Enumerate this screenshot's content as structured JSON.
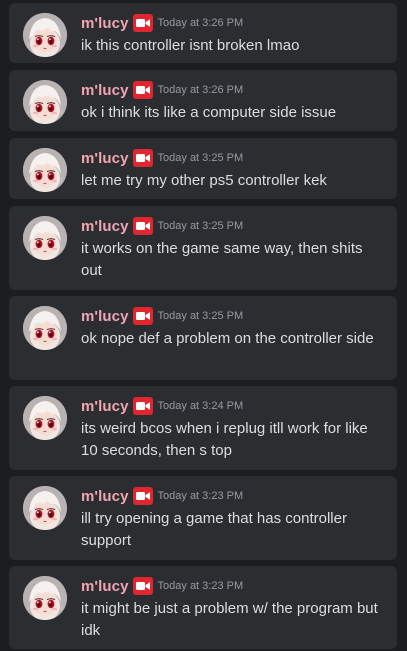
{
  "colors": {
    "background": "#1c1d21",
    "card": "#2b2d31",
    "username": "#f0a6b0",
    "badge": "#e0262f",
    "timestamp": "#949ba4",
    "message_text": "#dbdee1"
  },
  "badge_icon": "video-camera-icon",
  "messages": [
    {
      "username": "m'lucy",
      "time": "Today at 3:26 PM",
      "text": "ik this controller isnt broken lmao"
    },
    {
      "username": "m'lucy",
      "time": "Today at 3:26 PM",
      "text": "ok i think its like a computer side issue"
    },
    {
      "username": "m'lucy",
      "time": "Today at 3:25 PM",
      "text": "let me try my other ps5 controller kek"
    },
    {
      "username": "m'lucy",
      "time": "Today at 3:25 PM",
      "text": "it works on the game same way, then shits out"
    },
    {
      "username": "m'lucy",
      "time": "Today at 3:25 PM",
      "text": "ok nope def a problem on the controller side"
    },
    {
      "username": "m'lucy",
      "time": "Today at 3:24 PM",
      "text": "its weird bcos when i replug itll work for like 10 seconds, then s top"
    },
    {
      "username": "m'lucy",
      "time": "Today at 3:23 PM",
      "text": "ill try opening a game that has controller support"
    },
    {
      "username": "m'lucy",
      "time": "Today at 3:23 PM",
      "text": "it might be just a problem w/ the program but idk"
    }
  ]
}
